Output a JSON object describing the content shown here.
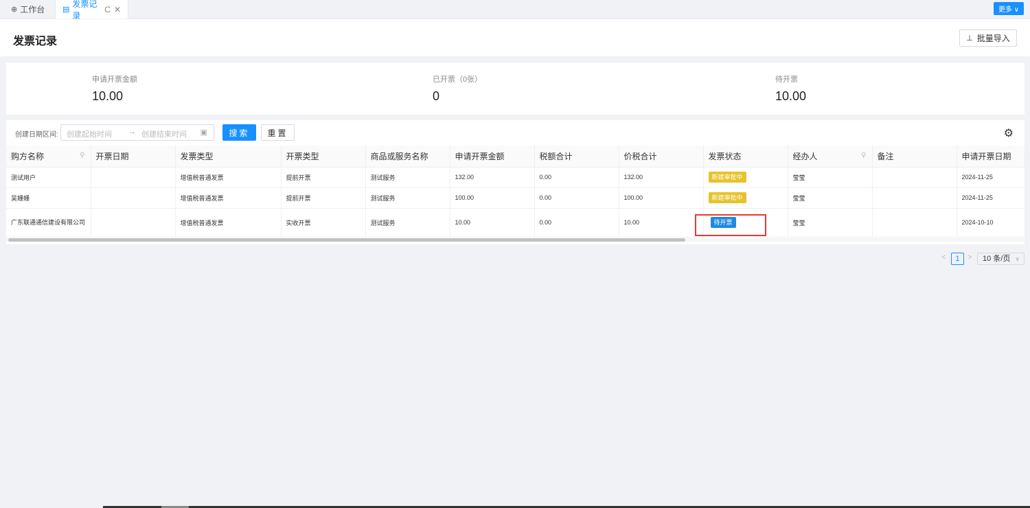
{
  "tabs": [
    {
      "icon": "⊕",
      "label": "工作台"
    },
    {
      "icon": "▤",
      "label": "发票记录",
      "refresh": "C",
      "close": "✕"
    }
  ],
  "more_button": "更多 ∨",
  "page": {
    "title": "发票记录",
    "import_label": "批量导入",
    "import_icon": "⊥"
  },
  "stats": [
    {
      "label": "申请开票金额",
      "value": "10.00"
    },
    {
      "label": "已开票（0张）",
      "value": "0"
    },
    {
      "label": "待开票",
      "value": "10.00"
    }
  ],
  "filter": {
    "label": "创建日期区间:",
    "start_placeholder": "创建起始时间",
    "arrow": "→",
    "end_placeholder": "创建结束时间",
    "calendar_icon": "▣",
    "search_label": "搜索",
    "reset_label": "重置",
    "settings_icon": "⚙"
  },
  "table": {
    "columns": [
      "购方名称",
      "开票日期",
      "发票类型",
      "开票类型",
      "商品或服务名称",
      "申请开票金额",
      "税额合计",
      "价税合计",
      "发票状态",
      "经办人",
      "备注",
      "申请开票日期"
    ],
    "search_icon": "🔍",
    "rows": [
      {
        "buyer": "测试用户",
        "date": "",
        "inv_type": "增值税普通发票",
        "issue_type": "提前开票",
        "service": "测试服务",
        "amount": "132.00",
        "tax": "0.00",
        "total": "132.00",
        "status": "新建审批中",
        "status_color": "#e6c32a",
        "handler": "莹莹",
        "note": "",
        "apply_date": "2024-11-25"
      },
      {
        "buyer": "吴姗姗",
        "date": "",
        "inv_type": "增值税普通发票",
        "issue_type": "提前开票",
        "service": "测试服务",
        "amount": "100.00",
        "tax": "0.00",
        "total": "100.00",
        "status": "新建审批中",
        "status_color": "#e6c32a",
        "handler": "莹莹",
        "note": "",
        "apply_date": "2024-11-25"
      },
      {
        "buyer": "广东联通通信建设有限公司",
        "date": "",
        "inv_type": "增值税普通发票",
        "issue_type": "实收开票",
        "service": "测试服务",
        "amount": "10.00",
        "tax": "0.00",
        "total": "10.00",
        "status": "待开票",
        "status_color": "#1e88e5",
        "handler": "莹莹",
        "note": "",
        "apply_date": "2024-10-10"
      }
    ]
  },
  "pagination": {
    "prev": "<",
    "current_page": "1",
    "next": ">",
    "page_size": "10 条/页",
    "dropdown": "∨"
  }
}
